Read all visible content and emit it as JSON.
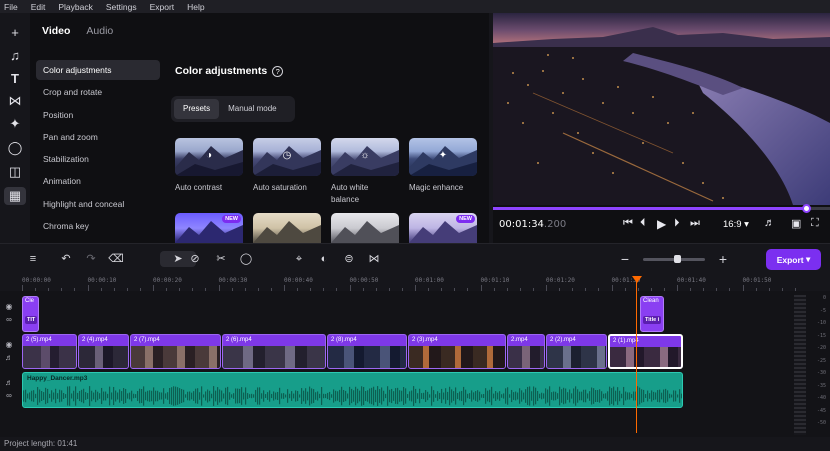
{
  "menu": [
    "File",
    "Edit",
    "Playback",
    "Settings",
    "Export",
    "Help"
  ],
  "rail_icons": [
    "add-icon",
    "music-icon",
    "text-icon",
    "transitions-icon",
    "effects-icon",
    "stickers-icon",
    "filters-icon",
    "more-tools-icon"
  ],
  "props": {
    "tabs": [
      "Video",
      "Audio"
    ],
    "menu_items": [
      "Color adjustments",
      "Crop and rotate",
      "Position",
      "Pan and zoom",
      "Stabilization",
      "Animation",
      "Highlight and conceal",
      "Chroma key"
    ],
    "section_title": "Color adjustments",
    "help_glyph": "?",
    "modes": [
      "Presets",
      "Manual mode"
    ],
    "presets": [
      {
        "label": "Auto contrast",
        "badge": ""
      },
      {
        "label": "Auto saturation",
        "badge": ""
      },
      {
        "label": "Auto white balance",
        "badge": ""
      },
      {
        "label": "Magic enhance",
        "badge": ""
      },
      {
        "label": "",
        "badge": "NEW"
      },
      {
        "label": "",
        "badge": ""
      },
      {
        "label": "",
        "badge": ""
      },
      {
        "label": "",
        "badge": "NEW"
      }
    ]
  },
  "preview": {
    "time_main": "00:01:34",
    "time_ms": ".200",
    "ratio": "16:9",
    "progress_fraction": 0.93
  },
  "timeline": {
    "toolbar_icons": [
      "add-track-icon",
      "undo-icon",
      "redo-icon",
      "delete-icon",
      "select-icon",
      "disable-icon",
      "cut-icon",
      "marker-icon",
      "crop-icon",
      "color-icon",
      "adjust-icon",
      "transition-icon",
      "zoom-out-icon",
      "zoom-in-icon"
    ],
    "export_label": "Export",
    "ruler": [
      "00:00:00",
      "00:00:10",
      "00:00:20",
      "00:00:30",
      "00:00:40",
      "00:00:50",
      "00:01:00",
      "00:01:10",
      "00:01:20",
      "00:01:30",
      "00:01:40",
      "00:01:50"
    ],
    "title_clips": [
      {
        "name": "Cle",
        "box": "TIT"
      },
      {
        "name": "Clean",
        "box": "Title i"
      }
    ],
    "video_clips": [
      "2 (5).mp4",
      "2 (4).mp4",
      "2 (7).mp4",
      "2 (6).mp4",
      "2 (8).mp4",
      "2 (3).mp4",
      "2.mp4",
      "2 (2).mp4",
      "2 (1).mp4"
    ],
    "audio_clip": "Happy_Dancer.mp3",
    "meter_levels": [
      "0",
      "-5",
      "-10",
      "-15",
      "-20",
      "-25",
      "-30",
      "-35",
      "-40",
      "-45",
      "-50"
    ]
  },
  "status": {
    "project_length": "Project length: 01:41"
  },
  "colors": {
    "accent": "#7b2ff0",
    "playhead": "#ff6a00",
    "audio": "#179e8a"
  }
}
